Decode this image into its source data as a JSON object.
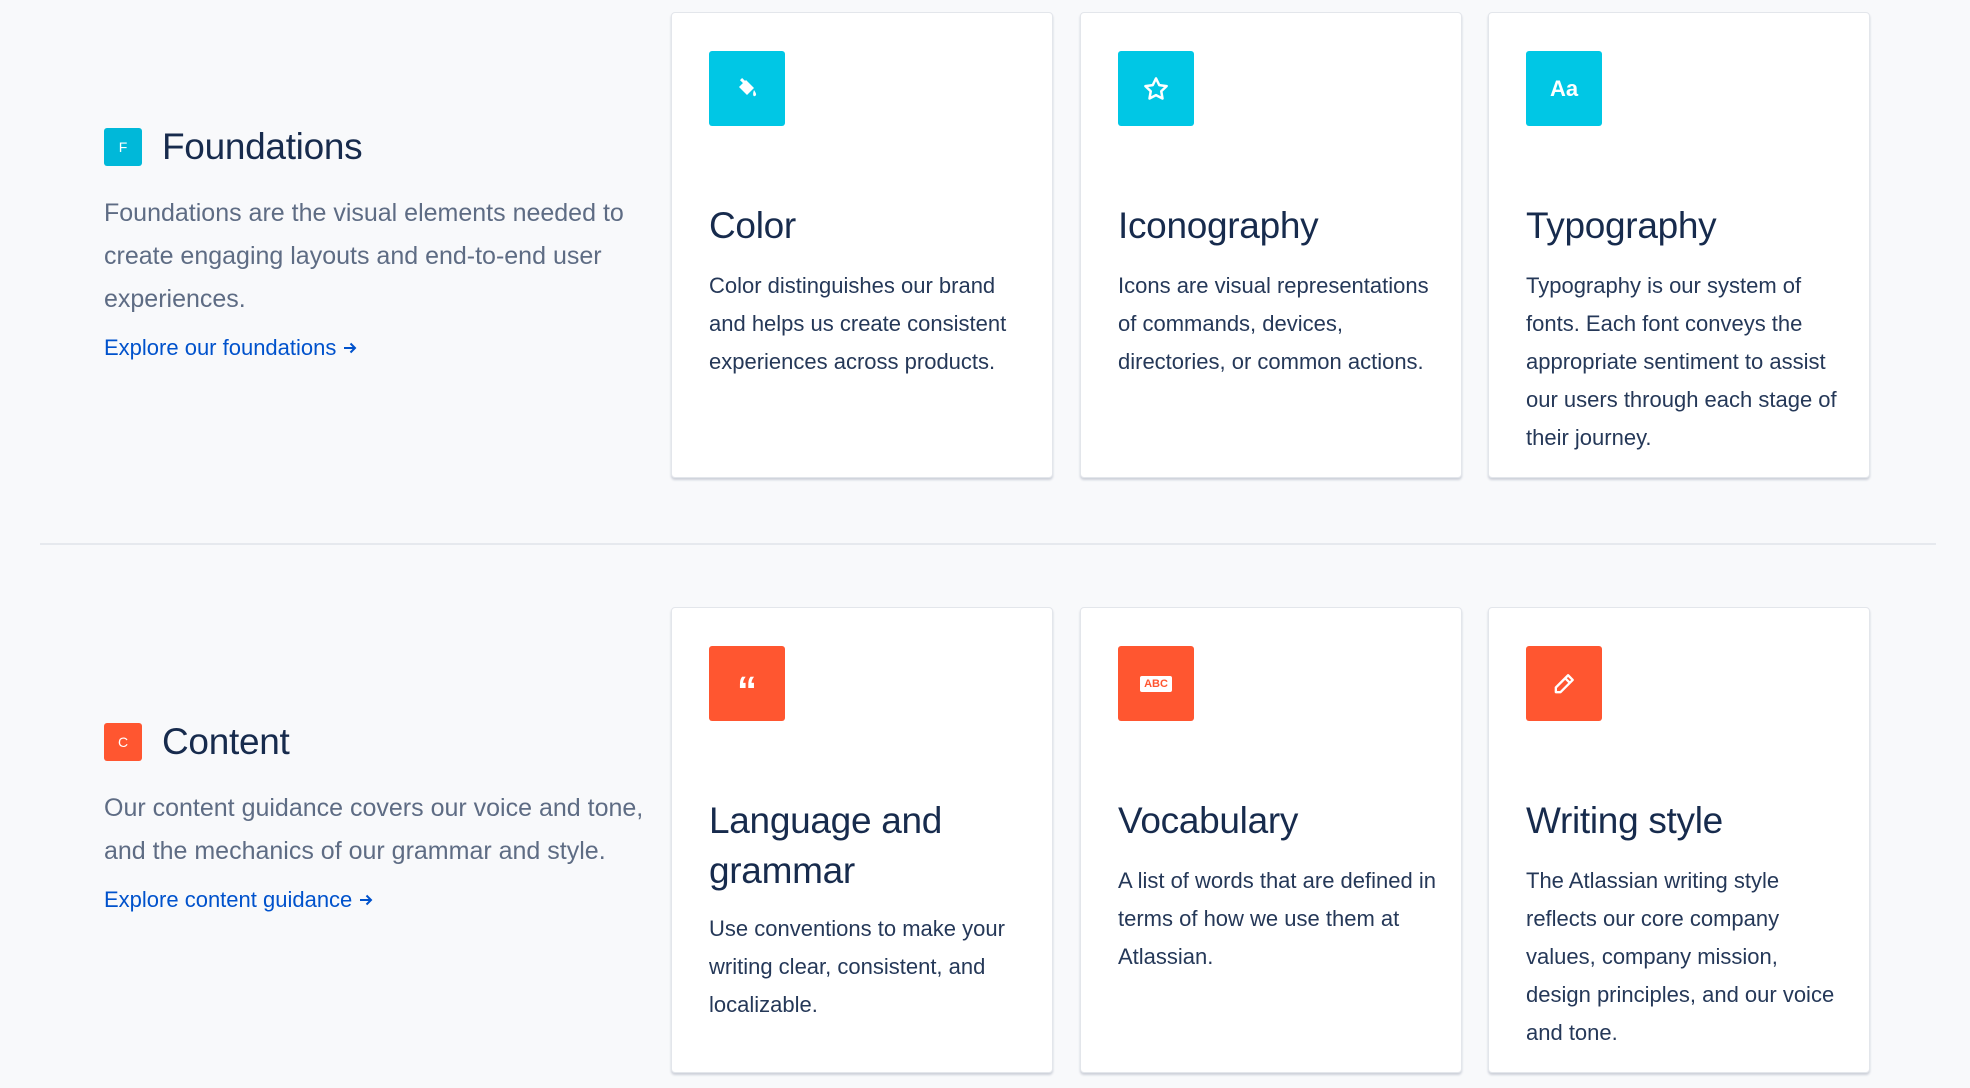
{
  "colors": {
    "foundations_accent": "#00c7e5",
    "content_accent": "#ff5630",
    "link": "#0052cc"
  },
  "sections": [
    {
      "badge": "F",
      "title": "Foundations",
      "description": "Foundations are the visual elements needed to create engaging layouts and end-to-end user experiences.",
      "link_label": "Explore our foundations",
      "cards": [
        {
          "icon": "paint-bucket-icon",
          "title": "Color",
          "description": "Color distinguishes our brand and helps us create consistent experiences across products."
        },
        {
          "icon": "star-icon",
          "title": "Iconography",
          "description": "Icons are visual representations of commands, devices, directories, or common actions."
        },
        {
          "icon": "typography-icon",
          "icon_text": "Aa",
          "title": "Typography",
          "description": "Typography is our system of fonts. Each font conveys the appropriate sentiment to assist our users through each stage of their journey."
        }
      ]
    },
    {
      "badge": "C",
      "title": "Content",
      "description": "Our content guidance covers our voice and tone, and the mechanics of our grammar and style.",
      "link_label": "Explore content guidance",
      "cards": [
        {
          "icon": "quote-icon",
          "icon_text": "“",
          "title": "Language and grammar",
          "description": "Use conventions to make your writing clear, consistent, and localizable."
        },
        {
          "icon": "abc-icon",
          "icon_text": "ABC",
          "title": "Vocabulary",
          "description": "A list of words that are defined in terms of how we use them at Atlassian."
        },
        {
          "icon": "pencil-icon",
          "title": "Writing style",
          "description": "The Atlassian writing style reflects our core company values, company mission, design principles, and our voice and tone."
        }
      ]
    }
  ]
}
